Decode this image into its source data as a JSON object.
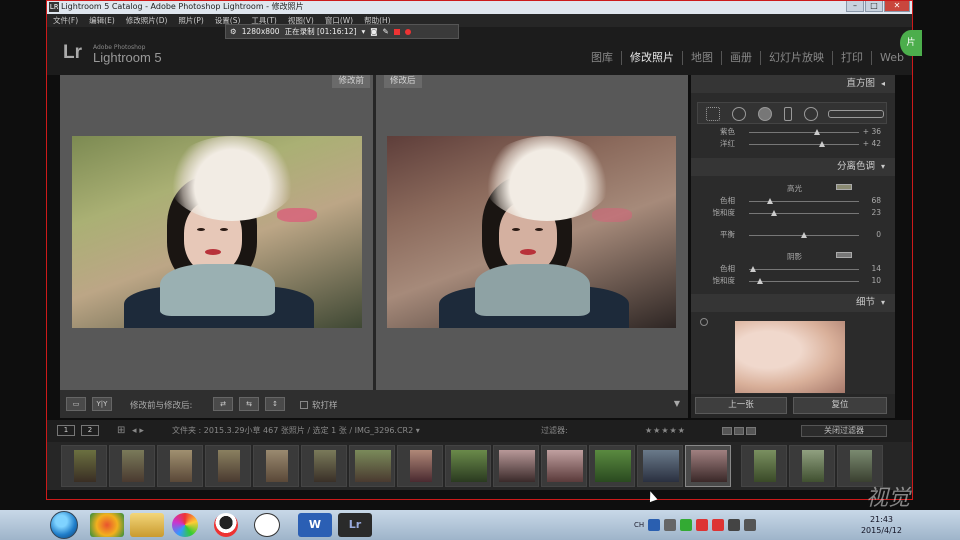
{
  "window": {
    "title": "Lightroom 5 Catalog - Adobe Photoshop Lightroom - 修改照片",
    "app_icon": "LR",
    "buttons": [
      "–",
      "□",
      "✕"
    ]
  },
  "menu": [
    "文件(F)",
    "编辑(E)",
    "修改照片(D)",
    "照片(P)",
    "设置(S)",
    "工具(T)",
    "视图(V)",
    "窗口(W)",
    "帮助(H)"
  ],
  "recorder": {
    "resolution": "1280x800",
    "status": "正在录制 [01:16:12]"
  },
  "header": {
    "logo": "Lr",
    "sub1": "Adobe Photoshop",
    "sub2": "Lightroom 5",
    "modules": [
      "图库",
      "修改照片",
      "地图",
      "画册",
      "幻灯片放映",
      "打印",
      "Web"
    ],
    "active_module": "修改照片"
  },
  "view": {
    "before_label": "修改前",
    "after_label": "修改后"
  },
  "toolbar": {
    "yy_label": "Y|Y",
    "mode_label": "修改前与修改后:",
    "soft_proof_label": "软打样",
    "dropdown_arrow": "▼"
  },
  "right_panel": {
    "histogram_title": "直方图",
    "tint_rows": [
      {
        "label": "紫色",
        "value": "+ 36",
        "pos": 0.62
      },
      {
        "label": "洋红",
        "value": "+ 42",
        "pos": 0.66
      }
    ],
    "split_title": "分离色调",
    "highlights_label": "高光",
    "highlights": [
      {
        "label": "色相",
        "value": "68",
        "pos": 0.19
      },
      {
        "label": "饱和度",
        "value": "23",
        "pos": 0.23
      }
    ],
    "balance": {
      "label": "平衡",
      "value": "0",
      "pos": 0.5
    },
    "shadows_label": "阴影",
    "shadows": [
      {
        "label": "色相",
        "value": "14",
        "pos": 0.04
      },
      {
        "label": "饱和度",
        "value": "10",
        "pos": 0.1
      }
    ],
    "detail_title": "细节",
    "prev_button": "上一张",
    "reset_button": "复位"
  },
  "filmstrip_bar": {
    "page1": "1",
    "page2": "2",
    "path": "文件夹 : 2015.3.29小草   467 张照片 / 选定 1 张 / IMG_3296.CR2 ▾",
    "filter_label": "过滤器:",
    "stars": "★★★★★",
    "close_filter": "关闭过滤器"
  },
  "taskbar": {
    "word": "W",
    "lr": "Lr",
    "tray_text": "CH",
    "time": "21:43",
    "date": "2015/4/12"
  },
  "watermark": "视觉",
  "side_badge": "片"
}
